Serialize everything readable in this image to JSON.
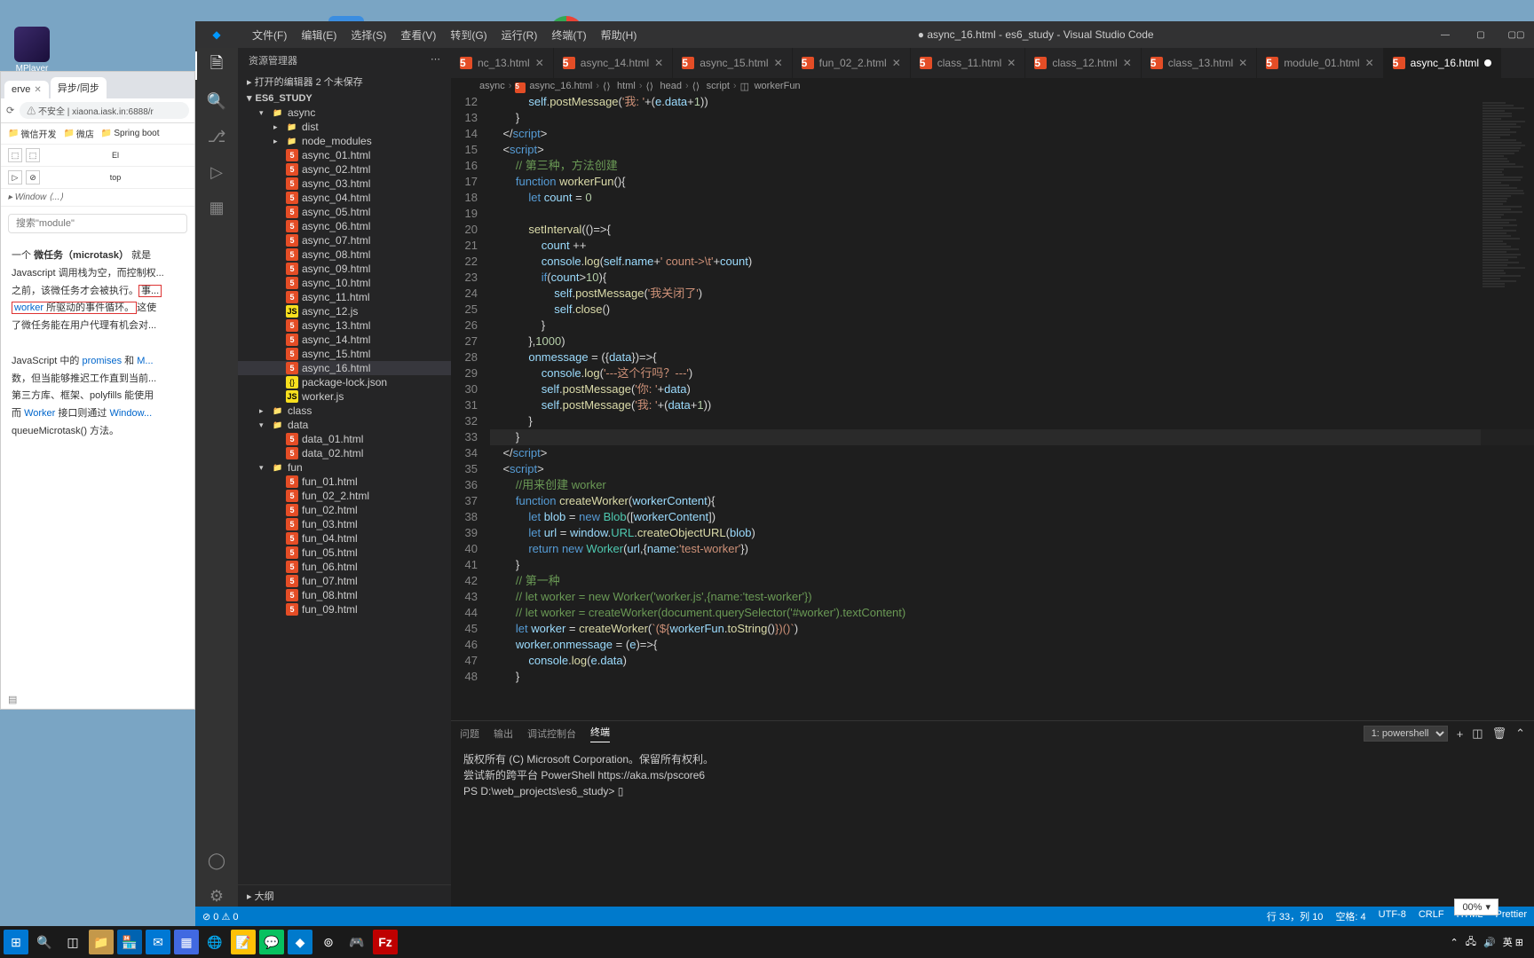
{
  "desktop": {
    "player_label": "MPlayer",
    "chrome_alt": "Chrome"
  },
  "chrome": {
    "tab1": "erve",
    "tab2": "异步/同步",
    "url_prefix": "不安全",
    "url": "xiaona.iask.in:6888/r",
    "bookmarks": [
      "微信开发",
      "微店",
      "Spring boot"
    ],
    "toolbar_btns": [
      "⬚",
      "⬚",
      "El"
    ],
    "toolbar_btns2": [
      "▷",
      "⊘",
      "top"
    ],
    "breadcrumb": "▸ Window ⟨...⟩",
    "search_ph": "搜索\"module\"",
    "para1a": "一个 ",
    "para1b": "微任务（microtask）",
    "para1c": " 就是",
    "para2": "Javascript 调用栈为空，而控制权...",
    "para3a": "之前，该微任务才会被执行。",
    "para3b": "事...",
    "para4a": "worker",
    "para4b": " 所驱动的事件循环。",
    "para4c": "这使",
    "para5": "了微任务能在用户代理有机会对...",
    "para6a": "JavaScript 中的 ",
    "para6b": "promises",
    "para6c": " 和 ",
    "para6d": "M...",
    "para7": "数，但当能够推迟工作直到当前...",
    "para8": "第三方库、框架、polyfills 能使用",
    "para9a": "而 ",
    "para9b": "Worker",
    "para9c": " 接口则通过 ",
    "para9d": "Window...",
    "para10": "queueMicrotask() 方法。"
  },
  "vscode": {
    "menus": [
      "文件(F)",
      "编辑(E)",
      "选择(S)",
      "查看(V)",
      "转到(G)",
      "运行(R)",
      "终端(T)",
      "帮助(H)"
    ],
    "title": "● async_16.html - es6_study - Visual Studio Code",
    "sidebar_title": "资源管理器",
    "open_editors": "▸ 打开的编辑器  2 个未保存",
    "workspace": "ES6_STUDY",
    "outline": "▸ 大纲",
    "tree": [
      {
        "d": 1,
        "caret": "▾",
        "ic": "folder",
        "label": "async"
      },
      {
        "d": 2,
        "caret": "▸",
        "ic": "folder",
        "label": "dist"
      },
      {
        "d": 2,
        "caret": "▸",
        "ic": "folder",
        "label": "node_modules"
      },
      {
        "d": 2,
        "ic": "html5",
        "label": "async_01.html"
      },
      {
        "d": 2,
        "ic": "html5",
        "label": "async_02.html"
      },
      {
        "d": 2,
        "ic": "html5",
        "label": "async_03.html"
      },
      {
        "d": 2,
        "ic": "html5",
        "label": "async_04.html"
      },
      {
        "d": 2,
        "ic": "html5",
        "label": "async_05.html"
      },
      {
        "d": 2,
        "ic": "html5",
        "label": "async_06.html"
      },
      {
        "d": 2,
        "ic": "html5",
        "label": "async_07.html"
      },
      {
        "d": 2,
        "ic": "html5",
        "label": "async_08.html"
      },
      {
        "d": 2,
        "ic": "html5",
        "label": "async_09.html"
      },
      {
        "d": 2,
        "ic": "html5",
        "label": "async_10.html"
      },
      {
        "d": 2,
        "ic": "html5",
        "label": "async_11.html"
      },
      {
        "d": 2,
        "ic": "js",
        "label": "async_12.js"
      },
      {
        "d": 2,
        "ic": "html5",
        "label": "async_13.html"
      },
      {
        "d": 2,
        "ic": "html5",
        "label": "async_14.html"
      },
      {
        "d": 2,
        "ic": "html5",
        "label": "async_15.html"
      },
      {
        "d": 2,
        "ic": "html5",
        "label": "async_16.html",
        "sel": true
      },
      {
        "d": 2,
        "ic": "json",
        "label": "package-lock.json"
      },
      {
        "d": 2,
        "ic": "js",
        "label": "worker.js"
      },
      {
        "d": 1,
        "caret": "▸",
        "ic": "folder",
        "label": "class"
      },
      {
        "d": 1,
        "caret": "▾",
        "ic": "folder",
        "label": "data"
      },
      {
        "d": 2,
        "ic": "html5",
        "label": "data_01.html"
      },
      {
        "d": 2,
        "ic": "html5",
        "label": "data_02.html"
      },
      {
        "d": 1,
        "caret": "▾",
        "ic": "folder",
        "label": "fun"
      },
      {
        "d": 2,
        "ic": "html5",
        "label": "fun_01.html"
      },
      {
        "d": 2,
        "ic": "html5",
        "label": "fun_02_2.html"
      },
      {
        "d": 2,
        "ic": "html5",
        "label": "fun_02.html"
      },
      {
        "d": 2,
        "ic": "html5",
        "label": "fun_03.html"
      },
      {
        "d": 2,
        "ic": "html5",
        "label": "fun_04.html"
      },
      {
        "d": 2,
        "ic": "html5",
        "label": "fun_05.html"
      },
      {
        "d": 2,
        "ic": "html5",
        "label": "fun_06.html"
      },
      {
        "d": 2,
        "ic": "html5",
        "label": "fun_07.html"
      },
      {
        "d": 2,
        "ic": "html5",
        "label": "fun_08.html"
      },
      {
        "d": 2,
        "ic": "html5",
        "label": "fun_09.html"
      }
    ],
    "tabs": [
      {
        "label": "nc_13.html"
      },
      {
        "label": "async_14.html"
      },
      {
        "label": "async_15.html"
      },
      {
        "label": "fun_02_2.html"
      },
      {
        "label": "class_11.html"
      },
      {
        "label": "class_12.html"
      },
      {
        "label": "class_13.html"
      },
      {
        "label": "module_01.html"
      },
      {
        "label": "async_16.html",
        "active": true,
        "dirty": true
      }
    ],
    "breadcrumb": [
      "async",
      "async_16.html",
      "html",
      "head",
      "script",
      "workerFun"
    ],
    "line_start": 12,
    "code_lines": [
      "            <span class='c-var'>self</span>.<span class='c-fn'>postMessage</span>(<span class='c-str'>'我: '</span>+(<span class='c-var'>e</span>.<span class='c-prop'>data</span>+<span class='c-num'>1</span>))",
      "        }",
      "    &lt;/<span class='c-tag'>script</span>&gt;",
      "    &lt;<span class='c-tag'>script</span>&gt;",
      "        <span class='c-com'>// 第三种，方法创建</span>",
      "        <span class='c-kw'>function</span> <span class='c-fn'>workerFun</span>(){",
      "            <span class='c-kw'>let</span> <span class='c-var'>count</span> = <span class='c-num'>0</span>",
      "",
      "            <span class='c-fn'>setInterval</span>(()=&gt;{",
      "                <span class='c-var'>count</span> ++",
      "                <span class='c-var'>console</span>.<span class='c-fn'>log</span>(<span class='c-var'>self</span>.<span class='c-prop'>name</span>+<span class='c-str'>' count-&gt;\\t'</span>+<span class='c-var'>count</span>)",
      "                <span class='c-kw'>if</span>(<span class='c-var'>count</span>&gt;<span class='c-num'>10</span>){",
      "                    <span class='c-var'>self</span>.<span class='c-fn'>postMessage</span>(<span class='c-str'>'我关闭了'</span>)",
      "                    <span class='c-var'>self</span>.<span class='c-fn'>close</span>()",
      "                }",
      "            },<span class='c-num'>1000</span>)",
      "            <span class='c-var'>onmessage</span> = ({<span class='c-var'>data</span>})=&gt;{",
      "                <span class='c-var'>console</span>.<span class='c-fn'>log</span>(<span class='c-str'>'---这个行吗？---'</span>)",
      "                <span class='c-var'>self</span>.<span class='c-fn'>postMessage</span>(<span class='c-str'>'你: '</span>+<span class='c-var'>data</span>)",
      "                <span class='c-var'>self</span>.<span class='c-fn'>postMessage</span>(<span class='c-str'>'我: '</span>+(<span class='c-var'>data</span>+<span class='c-num'>1</span>))",
      "            }",
      "        }",
      "    &lt;/<span class='c-tag'>script</span>&gt;",
      "    &lt;<span class='c-tag'>script</span>&gt;",
      "        <span class='c-com'>//用来创建 worker</span>",
      "        <span class='c-kw'>function</span> <span class='c-fn'>createWorker</span>(<span class='c-var'>workerContent</span>){",
      "            <span class='c-kw'>let</span> <span class='c-var'>blob</span> = <span class='c-kw'>new</span> <span class='c-type'>Blob</span>([<span class='c-var'>workerContent</span>])",
      "            <span class='c-kw'>let</span> <span class='c-var'>url</span> = <span class='c-var'>window</span>.<span class='c-type'>URL</span>.<span class='c-fn'>createObjectURL</span>(<span class='c-var'>blob</span>)",
      "            <span class='c-kw'>return</span> <span class='c-kw'>new</span> <span class='c-type'>Worker</span>(<span class='c-var'>url</span>,{<span class='c-prop'>name</span>:<span class='c-str'>'test-worker'</span>})",
      "        }",
      "        <span class='c-com'>// 第一种</span>",
      "        <span class='c-com'>// let worker = new Worker('worker.js',{name:'test-worker'})</span>",
      "        <span class='c-com'>// let worker = createWorker(document.querySelector('#worker').textContent)</span>",
      "        <span class='c-kw'>let</span> <span class='c-var'>worker</span> = <span class='c-fn'>createWorker</span>(<span class='c-str'>`(${</span><span class='c-var'>workerFun</span>.<span class='c-fn'>toString</span>()<span class='c-str'>})()`</span>)",
      "        <span class='c-var'>worker</span>.<span class='c-prop'>onmessage</span> = (<span class='c-var'>e</span>)=&gt;{",
      "            <span class='c-var'>console</span>.<span class='c-fn'>log</span>(<span class='c-var'>e</span>.<span class='c-prop'>data</span>)",
      "        }"
    ],
    "panel_tabs": [
      "问题",
      "输出",
      "调试控制台",
      "终端"
    ],
    "panel_active": "终端",
    "terminal_dropdown": "1: powershell",
    "terminal_lines": [
      "版权所有 (C) Microsoft Corporation。保留所有权利。",
      "",
      "尝试新的跨平台 PowerShell https://aka.ms/pscore6",
      "",
      "PS D:\\web_projects\\es6_study> ▯"
    ],
    "status_errors": "⊘ 0  ⚠ 0",
    "status_right": [
      "行 33，列 10",
      "空格: 4",
      "UTF-8",
      "CRLF",
      "HTML",
      "Prettier"
    ]
  },
  "zoom": "00%",
  "tray_ime": "英  ⊞"
}
